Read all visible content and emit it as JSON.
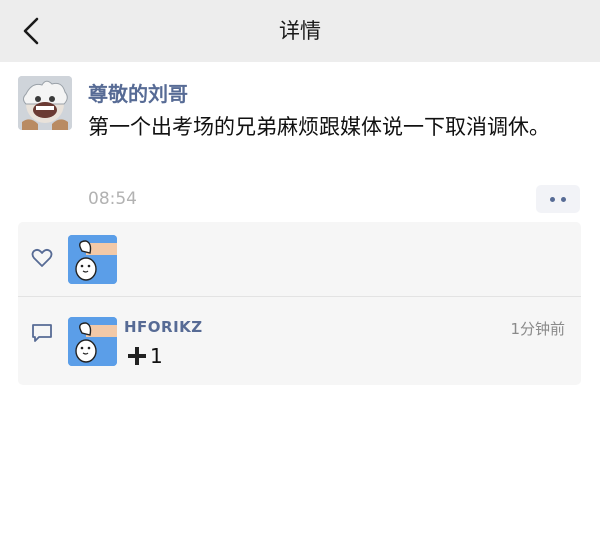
{
  "navbar": {
    "title": "详情",
    "back_icon": "chevron-left-icon"
  },
  "post": {
    "author": "尊敬的刘哥",
    "text": "第一个出考场的兄弟麻烦跟媒体说一下取消调休。",
    "time": "08:54",
    "more_icon": "more-dots-icon"
  },
  "likes": {
    "icon": "heart-icon"
  },
  "comments": [
    {
      "author": "HFORIKZ",
      "time": "1分钟前",
      "text": "1",
      "prefix_icon": "plus-icon"
    }
  ],
  "colors": {
    "navbar_bg": "#ededed",
    "link_blue": "#576b95",
    "panel_bg": "#f6f6f6",
    "avatar_blue": "#5b9ee8"
  }
}
